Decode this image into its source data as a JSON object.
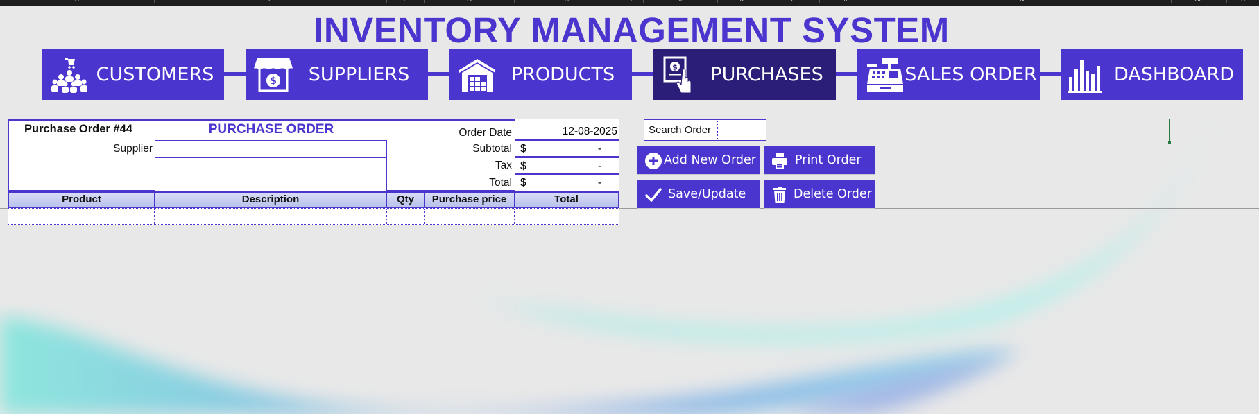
{
  "title": "INVENTORY MANAGEMENT SYSTEM",
  "column_letters": [
    "D",
    "E",
    "F",
    "G",
    "H",
    "I",
    "J",
    "K",
    "L",
    "M",
    "N",
    "BE",
    "B"
  ],
  "nav": {
    "active": "purchases",
    "items": [
      {
        "id": "customers",
        "label": "CUSTOMERS",
        "icon": "customers-icon"
      },
      {
        "id": "suppliers",
        "label": "SUPPLIERS",
        "icon": "store-dollar-icon"
      },
      {
        "id": "products",
        "label": "PRODUCTS",
        "icon": "warehouse-icon"
      },
      {
        "id": "purchases",
        "label": "PURCHASES",
        "icon": "invoice-hand-icon"
      },
      {
        "id": "sales",
        "label": "SALES ORDER",
        "icon": "cash-register-icon"
      },
      {
        "id": "dashboard",
        "label": "DASHBOARD",
        "icon": "bar-chart-icon"
      }
    ]
  },
  "form": {
    "po_number": "Purchase Order #44",
    "heading": "PURCHASE ORDER",
    "supplier_label": "Supplier",
    "supplier_value": "",
    "order_date_label": "Order Date",
    "order_date": "12-08-2025",
    "subtotal_label": "Subtotal",
    "tax_label": "Tax",
    "total_label": "Total",
    "currency": "$",
    "subtotal_value": "-",
    "tax_value": "-",
    "total_value": "-"
  },
  "table": {
    "columns": [
      "Product",
      "Description",
      "Qty",
      "Purchase price",
      "Total"
    ],
    "rows": [
      [
        "",
        "",
        "",
        "",
        ""
      ]
    ]
  },
  "search": {
    "label": "Search Order",
    "value": ""
  },
  "actions": {
    "add": "Add New Order",
    "print": "Print Order",
    "save": "Save/Update",
    "delete": "Delete Order"
  },
  "colors": {
    "accent": "#4a35cf",
    "active": "#2a1e78",
    "background": "#e8e8e8"
  }
}
